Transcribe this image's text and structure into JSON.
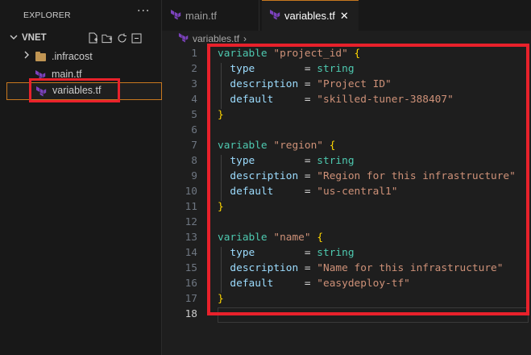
{
  "sidebar": {
    "title": "EXPLORER",
    "more": "···",
    "folder": "VNET",
    "items": [
      {
        "label": ".infracost",
        "kind": "folder"
      },
      {
        "label": "main.tf",
        "kind": "file"
      },
      {
        "label": "variables.tf",
        "kind": "file",
        "selected": true
      }
    ]
  },
  "tabs": [
    {
      "label": "main.tf",
      "active": false
    },
    {
      "label": "variables.tf",
      "active": true,
      "close": "✕"
    }
  ],
  "breadcrumb": {
    "file": "variables.tf",
    "sep": "›"
  },
  "editor": {
    "current_line": 18,
    "lines": [
      {
        "n": "1",
        "tokens": [
          [
            "kw",
            "variable"
          ],
          [
            "op",
            " "
          ],
          [
            "str",
            "\"project_id\""
          ],
          [
            "op",
            " "
          ],
          [
            "brace",
            "{"
          ]
        ]
      },
      {
        "n": "2",
        "tokens": [
          [
            "op",
            "  "
          ],
          [
            "prop",
            "type"
          ],
          [
            "op",
            "        = "
          ],
          [
            "kw",
            "string"
          ]
        ]
      },
      {
        "n": "3",
        "tokens": [
          [
            "op",
            "  "
          ],
          [
            "prop",
            "description"
          ],
          [
            "op",
            " = "
          ],
          [
            "str",
            "\"Project ID\""
          ]
        ]
      },
      {
        "n": "4",
        "tokens": [
          [
            "op",
            "  "
          ],
          [
            "prop",
            "default"
          ],
          [
            "op",
            "     = "
          ],
          [
            "str",
            "\"skilled-tuner-388407\""
          ]
        ]
      },
      {
        "n": "5",
        "tokens": [
          [
            "brace",
            "}"
          ]
        ]
      },
      {
        "n": "6",
        "tokens": []
      },
      {
        "n": "7",
        "tokens": [
          [
            "kw",
            "variable"
          ],
          [
            "op",
            " "
          ],
          [
            "str",
            "\"region\""
          ],
          [
            "op",
            " "
          ],
          [
            "brace",
            "{"
          ]
        ]
      },
      {
        "n": "8",
        "tokens": [
          [
            "op",
            "  "
          ],
          [
            "prop",
            "type"
          ],
          [
            "op",
            "        = "
          ],
          [
            "kw",
            "string"
          ]
        ]
      },
      {
        "n": "9",
        "tokens": [
          [
            "op",
            "  "
          ],
          [
            "prop",
            "description"
          ],
          [
            "op",
            " = "
          ],
          [
            "str",
            "\"Region for this infrastructure\""
          ]
        ]
      },
      {
        "n": "10",
        "tokens": [
          [
            "op",
            "  "
          ],
          [
            "prop",
            "default"
          ],
          [
            "op",
            "     = "
          ],
          [
            "str",
            "\"us-central1\""
          ]
        ]
      },
      {
        "n": "11",
        "tokens": [
          [
            "brace",
            "}"
          ]
        ]
      },
      {
        "n": "12",
        "tokens": []
      },
      {
        "n": "13",
        "tokens": [
          [
            "kw",
            "variable"
          ],
          [
            "op",
            " "
          ],
          [
            "str",
            "\"name\""
          ],
          [
            "op",
            " "
          ],
          [
            "brace",
            "{"
          ]
        ]
      },
      {
        "n": "14",
        "tokens": [
          [
            "op",
            "  "
          ],
          [
            "prop",
            "type"
          ],
          [
            "op",
            "        = "
          ],
          [
            "kw",
            "string"
          ]
        ]
      },
      {
        "n": "15",
        "tokens": [
          [
            "op",
            "  "
          ],
          [
            "prop",
            "description"
          ],
          [
            "op",
            " = "
          ],
          [
            "str",
            "\"Name for this infrastructure\""
          ]
        ]
      },
      {
        "n": "16",
        "tokens": [
          [
            "op",
            "  "
          ],
          [
            "prop",
            "default"
          ],
          [
            "op",
            "     = "
          ],
          [
            "str",
            "\"easydeploy-tf\""
          ]
        ]
      },
      {
        "n": "17",
        "tokens": [
          [
            "brace",
            "}"
          ]
        ]
      },
      {
        "n": "18",
        "tokens": []
      }
    ]
  },
  "colors": {
    "accent": "#c8781f",
    "highlight": "#e8212b",
    "terraform": "#7b42bc"
  }
}
